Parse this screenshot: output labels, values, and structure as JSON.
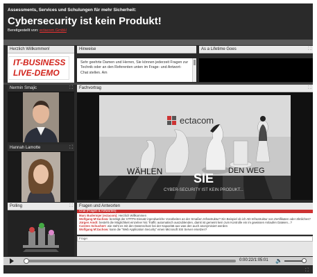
{
  "header": {
    "subtitle": "Assessments, Services und Schulungen für mehr Sicherheit:",
    "title": "Cybersecurity ist kein Produkt!",
    "provided_by_label": "Bereitgestellt von:",
    "provided_by_link": "ectacom GmbH"
  },
  "panels": {
    "welcome": {
      "title": "Herzlich Willkommen!",
      "logo_line1": "IT-BUSINESS",
      "logo_line2": "LIVE-DEMO"
    },
    "hinweise": {
      "title": "Hinweise",
      "text": "Sehr geehrte Damen und Herren, Sie können jederzeit Fragen zur Technik oder an den Referenten unten im Frage- und Antwort-Chat stellen. Am"
    },
    "lifetime": {
      "title": "As a Lifetime Goes"
    },
    "speaker1": {
      "title": "Nermin Smajic"
    },
    "speaker2": {
      "title": "Hannah Lamotte"
    },
    "fachvortrag": {
      "title": "Fachvortrag",
      "brand": "ectacom",
      "word1": "WÄHLEN",
      "word2": "SIE",
      "word3": "DEN WEG",
      "tagline": "CYBER-SECURITY IST KEIN PRODUKT..."
    },
    "polling": {
      "title": "Polling"
    },
    "qa": {
      "title": "Fragen und Antworten",
      "chat_header": "Chat (Fragen & Antworten)",
      "messages": [
        {
          "name": "Marc Budermjer (ectacom):",
          "text": "Herzlich Willkommen"
        },
        {
          "name": "Wolfgang M'Zachow:",
          "text": "benötigt der HTTPS Einsatz irgendwelche Vorarbeiten an der Smaßen Infrastruktur? Ein Beispiel ob ich AD-Infrastruktur von Zertifikaten oder ähnliches?"
        },
        {
          "name": "Jürgen Amdt:",
          "text": "besteht die Möglichkeit einzelner Nic Traffic automatisch auszublenden, damit ist gemeint kein zum Kontrolle ein im gewissen Anlaufen Dateien...?"
        },
        {
          "name": "Carsten Schuchert:",
          "text": "wie steht es mit den Datenschutz bei der Kapazität aus was den auch anonymisiert werden"
        },
        {
          "name": "Wolfgang M'Zachow:",
          "text": "kann die \"Web Application Security\" einen Microsoft SSI Server ersetzen?"
        }
      ],
      "input_label": "Frage:"
    }
  },
  "player": {
    "time": "0:00:22/1:05:01"
  },
  "icons": {
    "maximize": "maximize-icon",
    "play": "play-icon",
    "volume": "volume-icon",
    "fullscreen": "fullscreen-icon"
  },
  "colors": {
    "logo_red": "#d2241c",
    "chat_red": "#cc3333",
    "panel_header_dark": "#2f2f2f"
  }
}
